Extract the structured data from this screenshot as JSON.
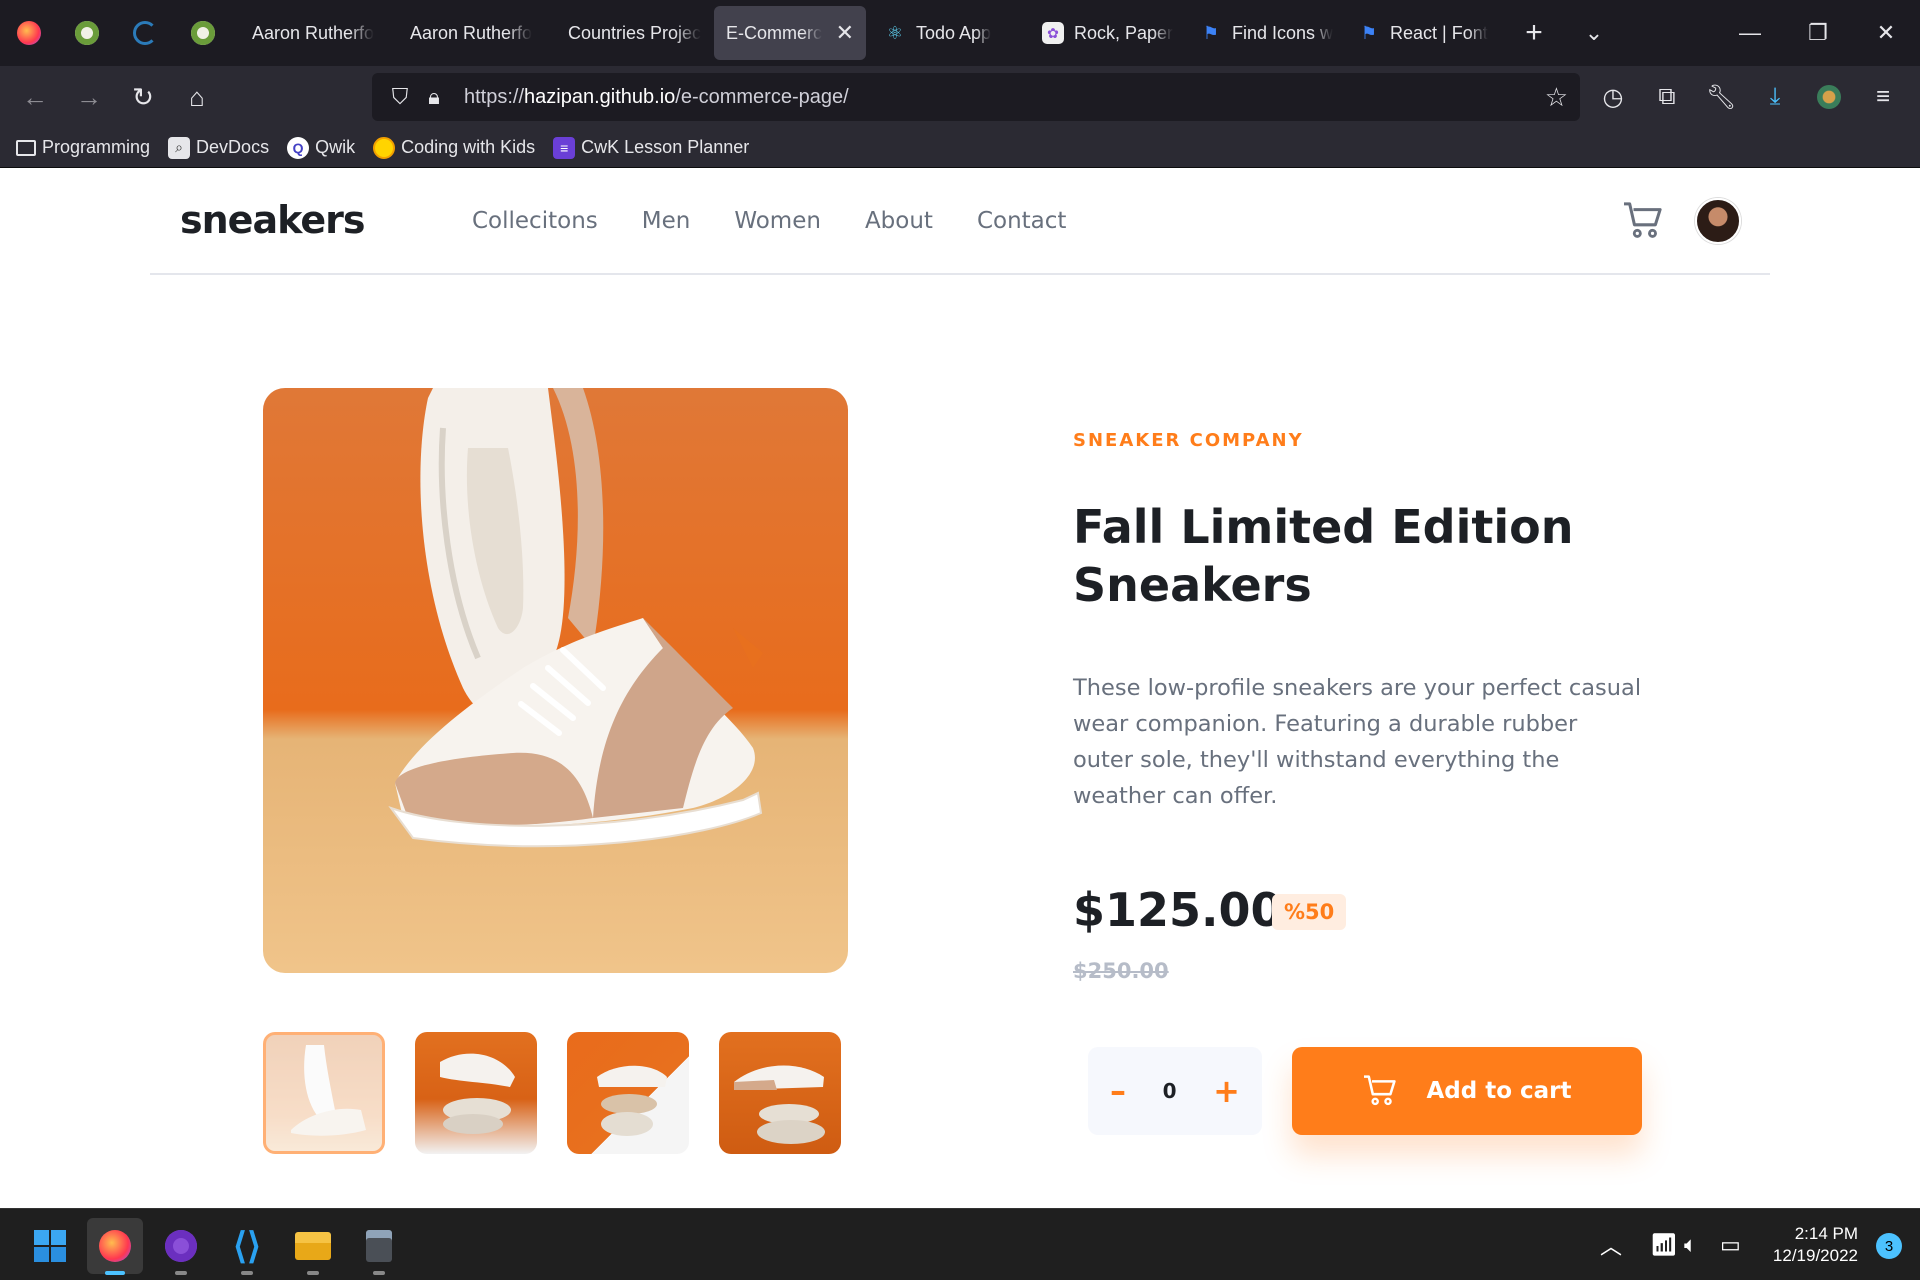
{
  "browser": {
    "tabs": [
      {
        "label": "Aaron Rutherfo",
        "active": false
      },
      {
        "label": "Aaron Rutherfo",
        "active": false
      },
      {
        "label": "Countries Projec",
        "active": false
      },
      {
        "label": "E-Commerce",
        "active": true
      },
      {
        "label": "Todo App",
        "active": false
      },
      {
        "label": "Rock, Paper",
        "active": false
      },
      {
        "label": "Find Icons w",
        "active": false
      },
      {
        "label": "React | Font",
        "active": false
      }
    ],
    "url_prefix": "https://",
    "url_host": "hazipan.github.io",
    "url_path": "/e-commerce-page/",
    "bookmarks": [
      "Programming",
      "DevDocs",
      "Qwik",
      "Coding with Kids",
      "CwK Lesson Planner"
    ]
  },
  "site": {
    "logo": "sneakers",
    "nav": [
      "Collecitons",
      "Men",
      "Women",
      "About",
      "Contact"
    ]
  },
  "product": {
    "company": "SNEAKER COMPANY",
    "title": "Fall Limited Edition Sneakers",
    "description": "These low-profile sneakers are your perfect casual wear companion. Featuring a durable rubber outer sole, they'll withstand everything the weather can offer.",
    "price": "$125.00",
    "discount": "%50",
    "original_price": "$250.00",
    "quantity": "0",
    "minus": "–",
    "plus": "+",
    "add_to_cart": "Add to cart",
    "thumbnail_count": 4,
    "selected_thumbnail": 1
  },
  "taskbar": {
    "time": "2:14 PM",
    "date": "12/19/2022",
    "notifications": "3"
  },
  "colors": {
    "accent": "#ff7d1a",
    "text_dark": "#1d2025",
    "text_grey": "#68707d"
  }
}
